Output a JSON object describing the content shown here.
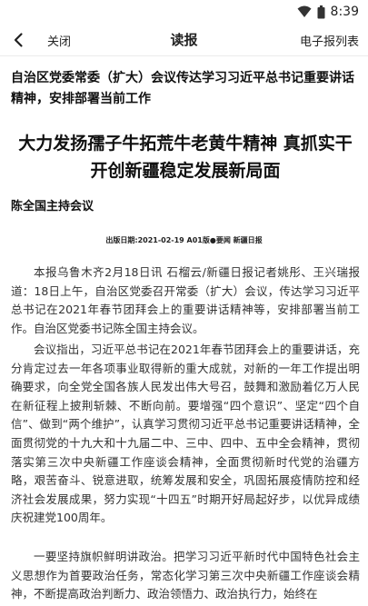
{
  "status_bar": {
    "time": "8:39",
    "icons": [
      "wifi-icon",
      "battery-icon"
    ]
  },
  "nav": {
    "back_icon": "chevron-left-icon",
    "close_label": "关闭",
    "title": "读报",
    "epaper_label": "电子报列表"
  },
  "article": {
    "kicker": "自治区党委常委（扩大）会议传达学习习近平总书记重要讲话精神，安排部署当前工作",
    "headline": "大力发扬孺子牛拓荒牛老黄牛精神 真抓实干开创新疆稳定发展新局面",
    "subhead": "陈全国主持会议",
    "meta": "出版日期:2021-02-19   A01版●要闻   新疆日报",
    "paragraphs": [
      "本报乌鲁木齐2月18日讯 石榴云/新疆日报记者姚彤、王兴瑞报道：18日上午，自治区党委召开常委（扩大）会议，传达学习习近平总书记在2021年春节团拜会上的重要讲话精神等，安排部署当前工作。自治区党委书记陈全国主持会议。",
      "会议指出，习近平总书记在2021年春节团拜会上的重要讲话，充分肯定过去一年各项事业取得新的重大成就，对新的一年工作提出明确要求，向全党全国各族人民发出伟大号召，鼓舞和激励着亿万人民在新征程上披荆斩棘、不断向前。要增强“四个意识”、坚定“四个自信”、做到“两个维护”，认真学习贯彻习近平总书记重要讲话精神，全面贯彻党的十九大和十九届二中、三中、四中、五中全会精神，贯彻落实第三次中央新疆工作座谈会精神，全面贯彻新时代党的治疆方略，艰苦奋斗、锐意进取，统筹发展和安全，巩固拓展疫情防控和经济社会发展成果，努力实现“十四五”时期开好局起好步，以优异成绩庆祝建党100周年。",
      "一要坚持旗帜鲜明讲政治。把学习习近平新时代中国特色社会主义思想作为首要政治任务，常态化学习第三次中央新疆工作座谈会精神，不断提高政治判断力、政治领悟力、政治执行力，始终在"
    ]
  }
}
